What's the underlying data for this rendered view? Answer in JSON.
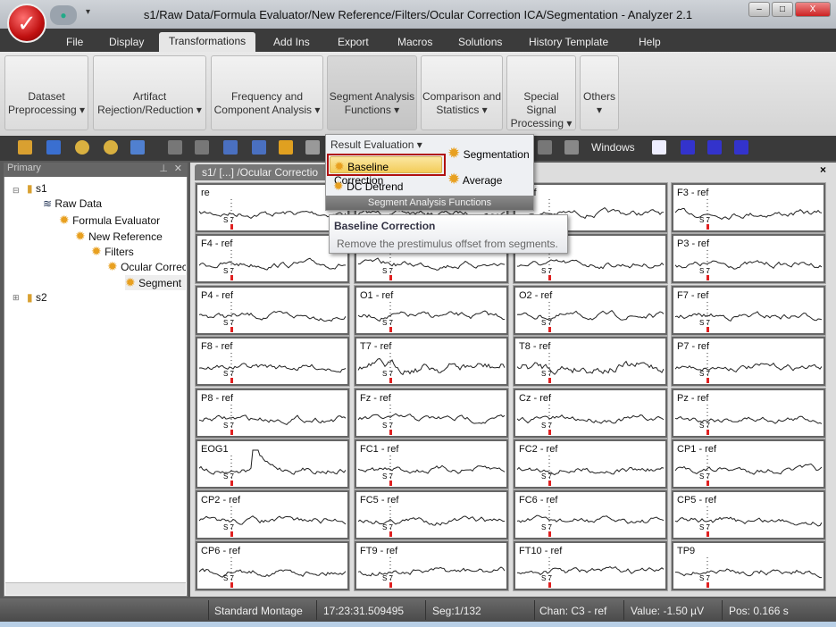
{
  "window": {
    "title": "s1/Raw Data/Formula Evaluator/New Reference/Filters/Ocular Correction ICA/Segmentation - Analyzer 2.1"
  },
  "menu": [
    "File",
    "Display",
    "Transformations",
    "Add Ins",
    "Export",
    "Macros",
    "Solutions",
    "History Template",
    "Help"
  ],
  "ribbon": [
    {
      "l1": "Dataset",
      "l2": "Preprocessing ▾"
    },
    {
      "l1": "Artifact",
      "l2": "Rejection/Reduction ▾"
    },
    {
      "l1": "Frequency and",
      "l2": "Component Analysis ▾"
    },
    {
      "l1": "Segment Analysis",
      "l2": "Functions ▾"
    },
    {
      "l1": "Comparison and",
      "l2": "Statistics ▾"
    },
    {
      "l1": "Special Signal",
      "l2": "Processing ▾"
    },
    {
      "l1": "Others",
      "l2": "▾"
    }
  ],
  "toolbar": {
    "windows_label": "Windows"
  },
  "popup": {
    "result_evaluation": "Result Evaluation ▾",
    "baseline": "Baseline Correction",
    "dc_detrend": "DC Detrend",
    "segmentation": "Segmentation",
    "average": "Average",
    "footer": "Segment Analysis Functions"
  },
  "tooltip": {
    "title": "Baseline Correction",
    "text": "Remove the prestimulus offset from segments."
  },
  "panel": {
    "title": "Primary",
    "tree": [
      "s1",
      "Raw Data",
      "Formula Evaluator",
      "New Reference",
      "Filters",
      "Ocular Correc",
      "Segment",
      "s2"
    ]
  },
  "doc": {
    "tab": "s1/ [...] /Ocular Correctio"
  },
  "channels": [
    "re",
    "",
    "- ref",
    "F3 - ref",
    "F4 - ref",
    "",
    "",
    "P3 - ref",
    "P4 - ref",
    "O1 - ref",
    "O2 - ref",
    "F7 - ref",
    "F8 - ref",
    "T7 - ref",
    "T8 - ref",
    "P7 - ref",
    "P8 - ref",
    "Fz - ref",
    "Cz - ref",
    "Pz - ref",
    "EOG1",
    "FC1 - ref",
    "FC2 - ref",
    "CP1 - ref",
    "CP2 - ref",
    "FC5 - ref",
    "FC6 - ref",
    "CP5 - ref",
    "CP6 - ref",
    "FT9 - ref",
    "FT10 - ref",
    "TP9"
  ],
  "marker_label": "S  7",
  "status": {
    "montage": "Standard Montage",
    "time": "17:23:31.509495",
    "seg": "Seg:1/132",
    "chan": "Chan:  C3 - ref",
    "value": "Value: -1.50 µV",
    "pos": "Pos:  0.166 s"
  },
  "colors": {
    "highlight": "#f7d774",
    "highlight_border": "#b01010",
    "marker": "#e02020"
  }
}
